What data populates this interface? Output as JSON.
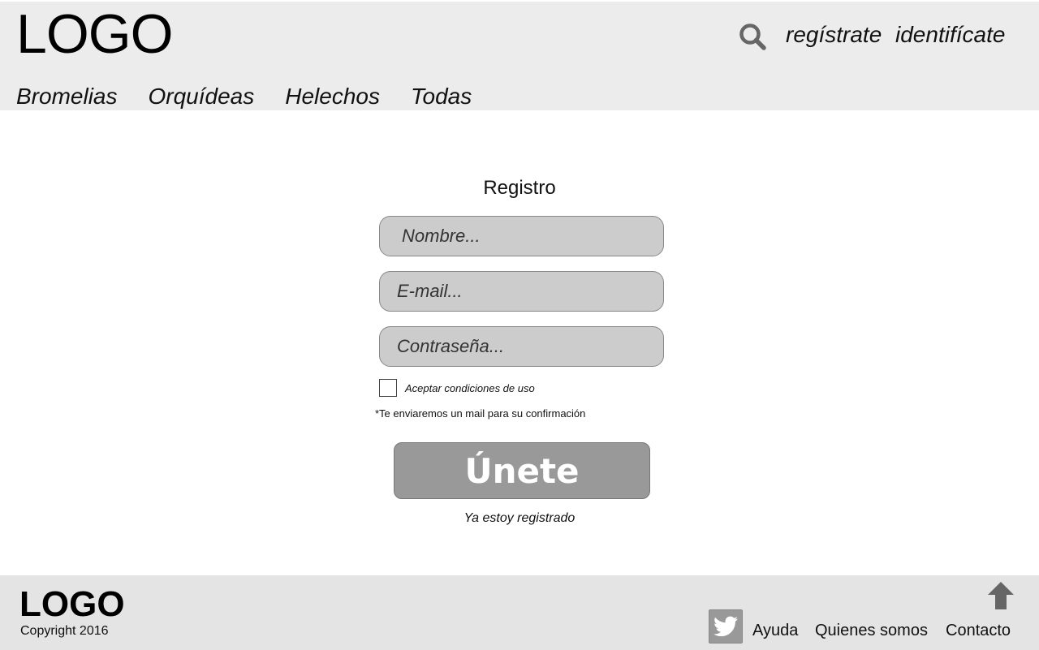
{
  "header": {
    "logo": "LOGO",
    "search_icon": "search-icon",
    "register_link": "regístrate",
    "login_link": "identifícate"
  },
  "nav": {
    "items": [
      "Bromelias",
      "Orquídeas",
      "Helechos",
      "Todas"
    ]
  },
  "form": {
    "title": "Registro",
    "name_placeholder": "Nombre...",
    "email_placeholder": "E-mail...",
    "password_placeholder": "Contraseña...",
    "terms_label": "Aceptar condiciones de uso",
    "terms_checked": false,
    "note": "*Te enviaremos un mail para su confirmación",
    "submit_label": "Únete",
    "already_registered": "Ya estoy registrado"
  },
  "footer": {
    "logo": "LOGO",
    "copyright": "Copyright 2016",
    "scroll_top_icon": "arrow-up-icon",
    "social_icon": "twitter-icon",
    "links": [
      "Ayuda",
      "Quienes somos",
      "Contacto"
    ]
  },
  "colors": {
    "header_bg": "#ececec",
    "footer_bg": "#e4e4e4",
    "field_bg": "#cccccc",
    "button_bg": "#999999",
    "icon_gray": "#666666"
  }
}
